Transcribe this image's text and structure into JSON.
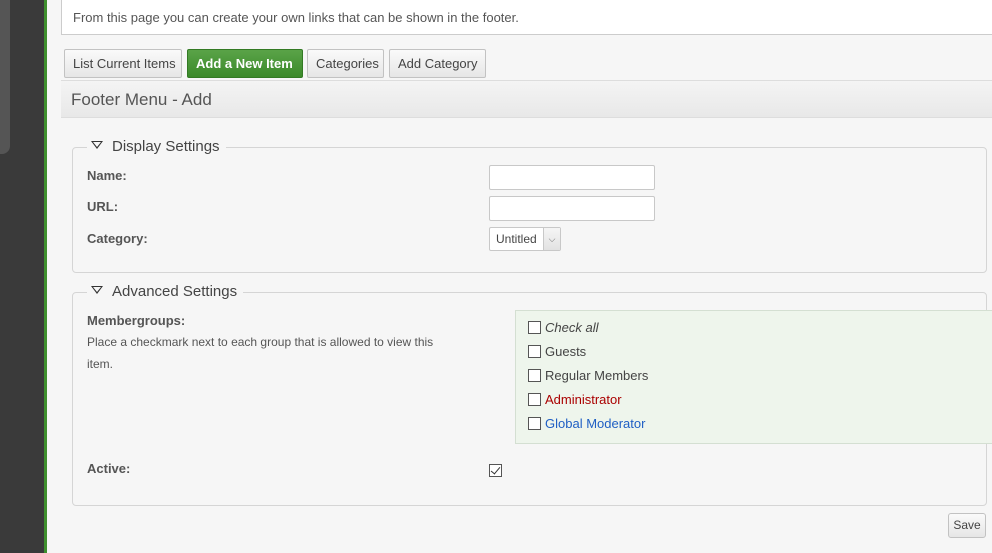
{
  "info": {
    "text": "From this page you can create your own links that can be shown in the footer."
  },
  "tabs": [
    {
      "label": "List Current Items"
    },
    {
      "label": "Add a New Item"
    },
    {
      "label": "Categories"
    },
    {
      "label": "Add Category"
    }
  ],
  "page_title": "Footer Menu - Add",
  "display_settings": {
    "legend": "Display Settings",
    "name_label": "Name:",
    "name_value": "",
    "url_label": "URL:",
    "url_value": "",
    "category_label": "Category:",
    "category_value": "Untitled"
  },
  "advanced_settings": {
    "legend": "Advanced Settings",
    "membergroups_label": "Membergroups:",
    "membergroups_desc": "Place a checkmark next to each group that is allowed to view this item.",
    "check_all": "Check all",
    "groups": [
      {
        "label": "Guests",
        "color": "#444444"
      },
      {
        "label": "Regular Members",
        "color": "#444444"
      },
      {
        "label": "Administrator",
        "color": "#aa0000"
      },
      {
        "label": "Global Moderator",
        "color": "#1f5fc4"
      }
    ],
    "active_label": "Active:"
  },
  "save_label": "Save"
}
